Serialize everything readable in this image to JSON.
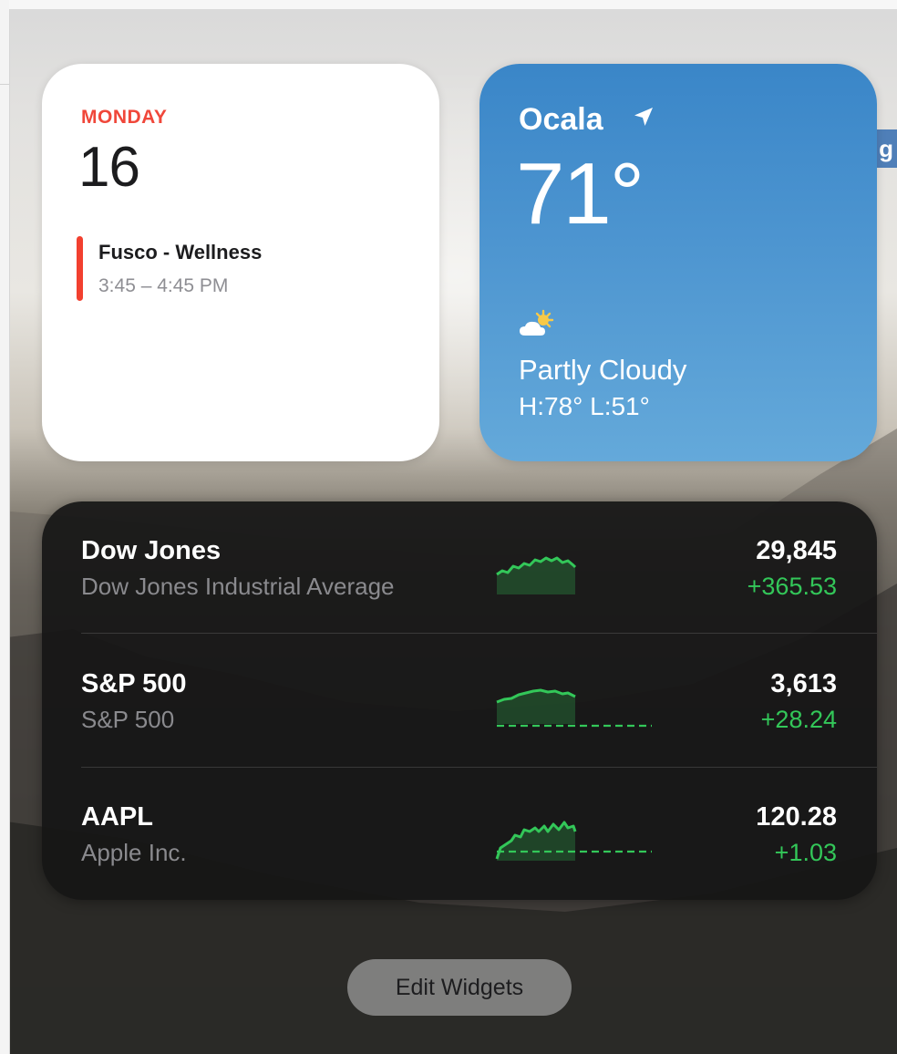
{
  "calendar": {
    "day": "MONDAY",
    "date": "16",
    "event_title": "Fusco - Wellness",
    "event_time": "3:45 – 4:45 PM",
    "accent_color": "#f0473a"
  },
  "weather": {
    "city": "Ocala",
    "location_icon": "location-arrow-icon",
    "temperature": "71°",
    "condition_icon": "partly-cloudy-icon",
    "condition": "Partly Cloudy",
    "high_low": "H:78° L:51°"
  },
  "stocks": [
    {
      "symbol": "Dow Jones",
      "name": "Dow Jones Industrial Average",
      "price": "29,845",
      "change": "+365.53"
    },
    {
      "symbol": "S&P 500",
      "name": "S&P 500",
      "price": "3,613",
      "change": "+28.24"
    },
    {
      "symbol": "AAPL",
      "name": "Apple Inc.",
      "price": "120.28",
      "change": "+1.03"
    }
  ],
  "colors": {
    "gain": "#33c759",
    "weather_bg": "#4d95d0"
  },
  "edit_widgets_label": "Edit Widgets"
}
